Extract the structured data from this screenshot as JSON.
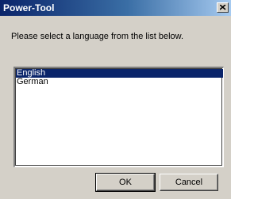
{
  "window": {
    "title": "Power-Tool",
    "close_icon": "close-icon"
  },
  "dialog": {
    "prompt": "Please select a language from the list below.",
    "languages": [
      {
        "label": "English",
        "selected": true
      },
      {
        "label": "German",
        "selected": false
      }
    ],
    "ok_label": "OK",
    "cancel_label": "Cancel"
  },
  "colors": {
    "title_bar_start": "#0a246a",
    "title_bar_end": "#a6caf0",
    "selection": "#0a246a",
    "face": "#d4d0c8"
  }
}
